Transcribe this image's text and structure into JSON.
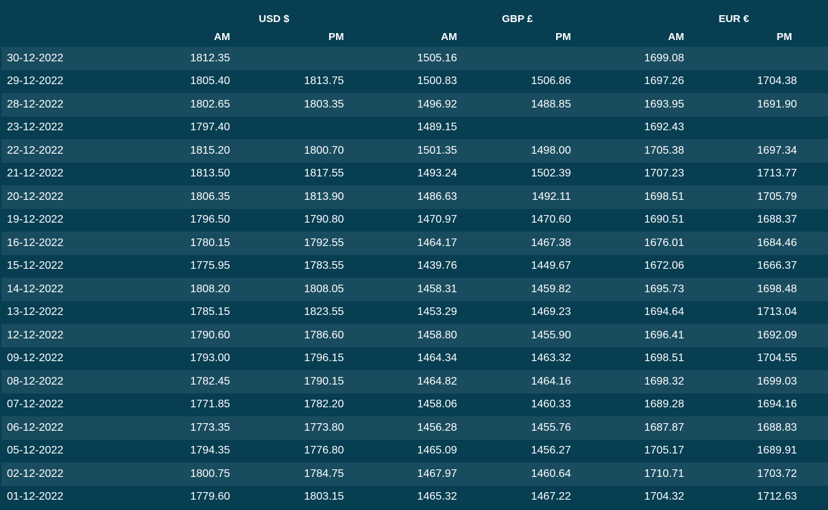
{
  "table": {
    "currencies": [
      "USD $",
      "GBP £",
      "EUR €"
    ],
    "subheaders": [
      "AM",
      "PM",
      "AM",
      "PM",
      "AM",
      "PM"
    ],
    "rows": [
      {
        "date": "30-12-2022",
        "values": [
          "1812.35",
          "",
          "1505.16",
          "",
          "1699.08",
          ""
        ]
      },
      {
        "date": "29-12-2022",
        "values": [
          "1805.40",
          "1813.75",
          "1500.83",
          "1506.86",
          "1697.26",
          "1704.38"
        ]
      },
      {
        "date": "28-12-2022",
        "values": [
          "1802.65",
          "1803.35",
          "1496.92",
          "1488.85",
          "1693.95",
          "1691.90"
        ]
      },
      {
        "date": "23-12-2022",
        "values": [
          "1797.40",
          "",
          "1489.15",
          "",
          "1692.43",
          ""
        ]
      },
      {
        "date": "22-12-2022",
        "values": [
          "1815.20",
          "1800.70",
          "1501.35",
          "1498.00",
          "1705.38",
          "1697.34"
        ]
      },
      {
        "date": "21-12-2022",
        "values": [
          "1813.50",
          "1817.55",
          "1493.24",
          "1502.39",
          "1707.23",
          "1713.77"
        ]
      },
      {
        "date": "20-12-2022",
        "values": [
          "1806.35",
          "1813.90",
          "1486.63",
          "1492.11",
          "1698.51",
          "1705.79"
        ]
      },
      {
        "date": "19-12-2022",
        "values": [
          "1796.50",
          "1790.80",
          "1470.97",
          "1470.60",
          "1690.51",
          "1688.37"
        ]
      },
      {
        "date": "16-12-2022",
        "values": [
          "1780.15",
          "1792.55",
          "1464.17",
          "1467.38",
          "1676.01",
          "1684.46"
        ]
      },
      {
        "date": "15-12-2022",
        "values": [
          "1775.95",
          "1783.55",
          "1439.76",
          "1449.67",
          "1672.06",
          "1666.37"
        ]
      },
      {
        "date": "14-12-2022",
        "values": [
          "1808.20",
          "1808.05",
          "1458.31",
          "1459.82",
          "1695.73",
          "1698.48"
        ]
      },
      {
        "date": "13-12-2022",
        "values": [
          "1785.15",
          "1823.55",
          "1453.29",
          "1469.23",
          "1694.64",
          "1713.04"
        ]
      },
      {
        "date": "12-12-2022",
        "values": [
          "1790.60",
          "1786.60",
          "1458.80",
          "1455.90",
          "1696.41",
          "1692.09"
        ]
      },
      {
        "date": "09-12-2022",
        "values": [
          "1793.00",
          "1796.15",
          "1464.34",
          "1463.32",
          "1698.51",
          "1704.55"
        ]
      },
      {
        "date": "08-12-2022",
        "values": [
          "1782.45",
          "1790.15",
          "1464.82",
          "1464.16",
          "1698.32",
          "1699.03"
        ]
      },
      {
        "date": "07-12-2022",
        "values": [
          "1771.85",
          "1782.20",
          "1458.06",
          "1460.33",
          "1689.28",
          "1694.16"
        ]
      },
      {
        "date": "06-12-2022",
        "values": [
          "1773.35",
          "1773.80",
          "1456.28",
          "1455.76",
          "1687.87",
          "1688.83"
        ]
      },
      {
        "date": "05-12-2022",
        "values": [
          "1794.35",
          "1776.80",
          "1465.09",
          "1456.27",
          "1705.17",
          "1689.91"
        ]
      },
      {
        "date": "02-12-2022",
        "values": [
          "1800.75",
          "1784.75",
          "1467.97",
          "1460.64",
          "1710.71",
          "1703.72"
        ]
      },
      {
        "date": "01-12-2022",
        "values": [
          "1779.60",
          "1803.15",
          "1465.32",
          "1467.22",
          "1704.32",
          "1712.63"
        ]
      }
    ]
  }
}
